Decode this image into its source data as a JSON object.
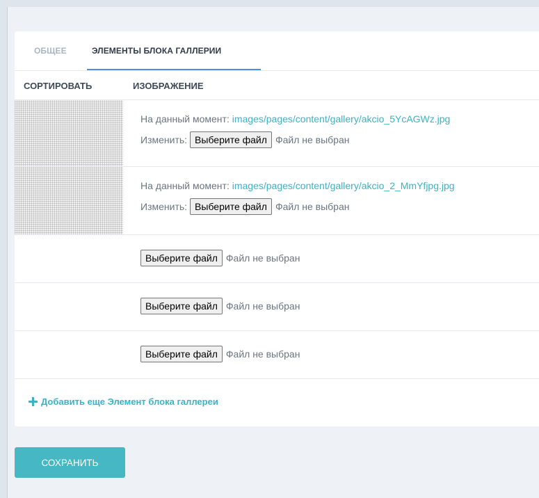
{
  "tabs": {
    "general": "ОБЩЕЕ",
    "elements": "ЭЛЕМЕНТЫ БЛОКА ГАЛЛЕРИИ"
  },
  "columns": {
    "sort": "СОРТИРОВАТЬ",
    "image": "ИЗОБРАЖЕНИЕ"
  },
  "rows": [
    {
      "current_label": "На данный момент:",
      "current_path": "images/pages/content/gallery/akcio_5YcAGWz.jpg",
      "change_label": "Изменить:",
      "button_label": "Выберите файл",
      "status": "Файл не выбран"
    },
    {
      "current_label": "На данный момент:",
      "current_path": "images/pages/content/gallery/akcio_2_MmYfjpg.jpg",
      "change_label": "Изменить:",
      "button_label": "Выберите файл",
      "status": "Файл не выбран"
    }
  ],
  "empty_rows": [
    {
      "button_label": "Выберите файл",
      "status": "Файл не выбран"
    },
    {
      "button_label": "Выберите файл",
      "status": "Файл не выбран"
    },
    {
      "button_label": "Выберите файл",
      "status": "Файл не выбран"
    }
  ],
  "add_more": "Добавить еще Элемент блока галлереи",
  "save_label": "СОХРАНИТЬ",
  "colors": {
    "accent": "#3bb3c3",
    "save_button": "#45b8c3",
    "tab_underline": "#4a90e2"
  }
}
